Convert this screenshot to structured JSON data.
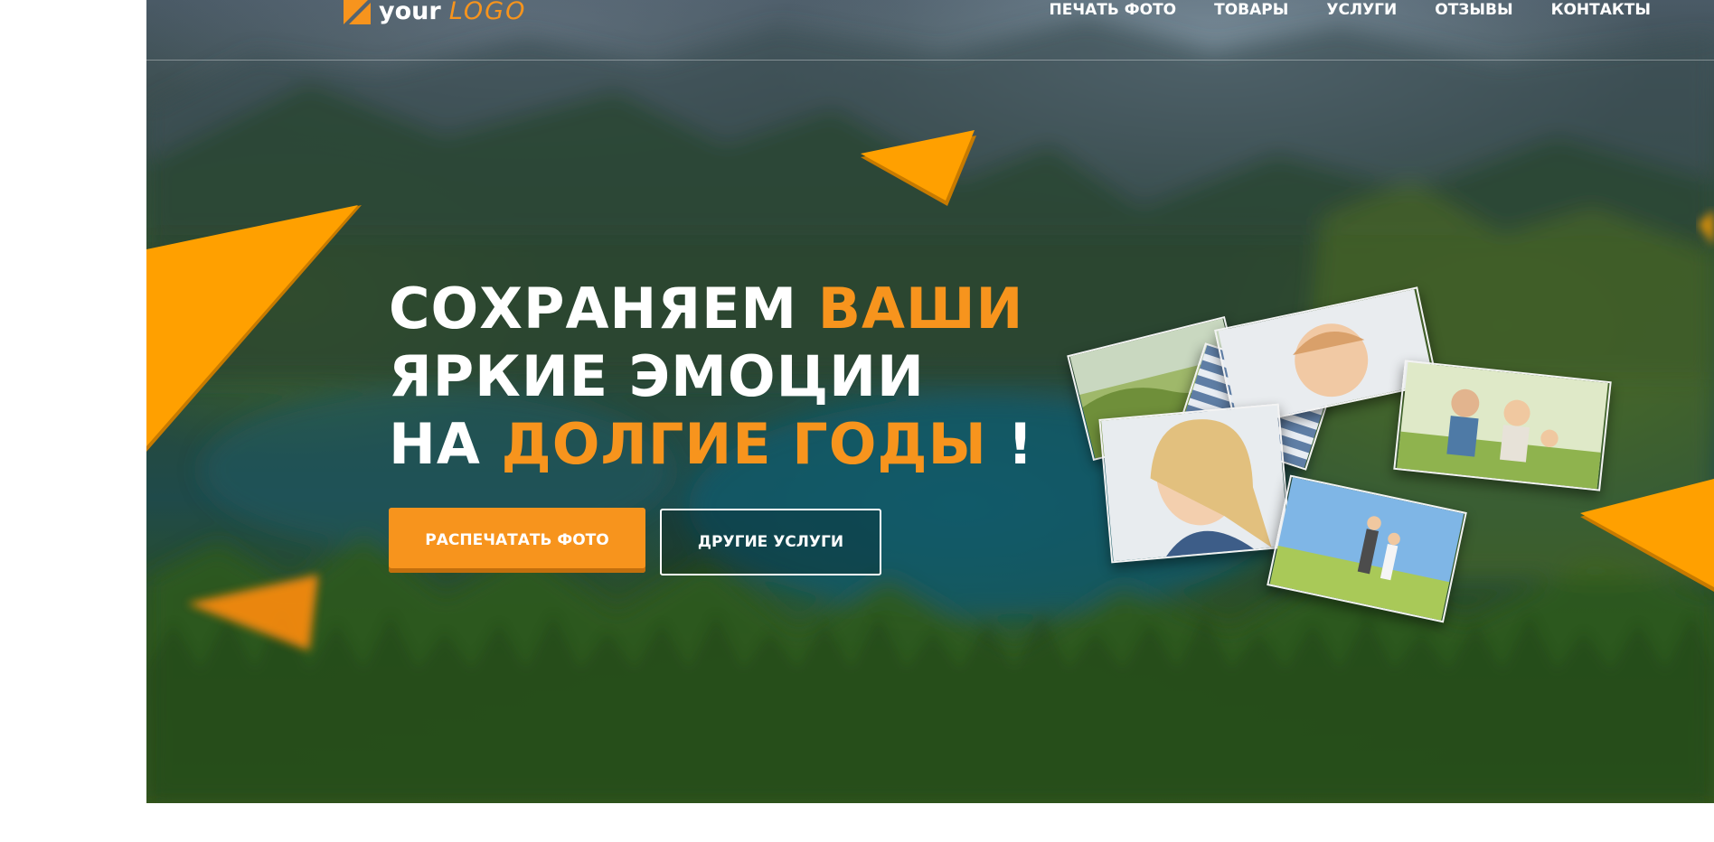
{
  "header": {
    "logo": {
      "your": "your",
      "logo": "LOGO"
    },
    "nav": [
      {
        "label": "ПЕЧАТЬ ФОТО"
      },
      {
        "label": "ТОВАРЫ"
      },
      {
        "label": "УСЛУГИ"
      },
      {
        "label": "ОТЗЫВЫ"
      },
      {
        "label": "КОНТАКТЫ"
      }
    ]
  },
  "hero": {
    "line1_white": "СОХРАНЯЕМ",
    "line1_orange": "ВАШИ",
    "line2_white": "ЯРКИЕ ЭМОЦИИ",
    "line3_white": "НА",
    "line3_orange": "ДОЛГИЕ ГОДЫ",
    "line3_end": "!",
    "primary_button": "РАСПЕЧАТАТЬ ФОТО",
    "secondary_button": "ДРУГИЕ УСЛУГИ"
  },
  "colors": {
    "accent": "#f7941d",
    "triangle": "#ffa000",
    "text": "#ffffff"
  },
  "icons": {
    "logo_mark": "orange-square-diagonal-icon",
    "photo_stack": "photo-stack-illustration"
  }
}
